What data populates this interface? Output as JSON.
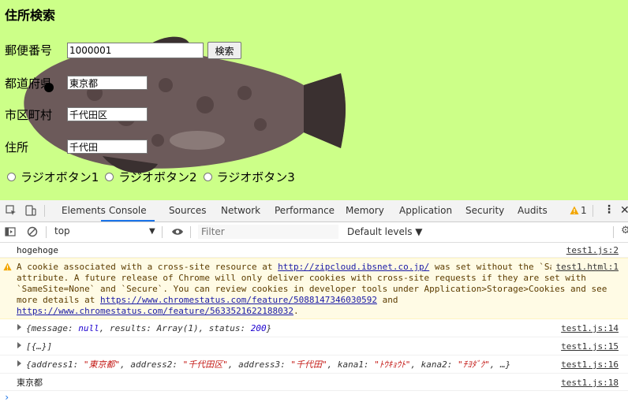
{
  "page": {
    "title": "住所検索",
    "zip_label": "郵便番号",
    "zip_value": "1000001",
    "search_button": "検索",
    "pref_label": "都道府県",
    "pref_value": "東京都",
    "city_label": "市区町村",
    "city_value": "千代田区",
    "address_label": "住所",
    "address_value": "千代田",
    "radios": [
      "ラジオボタン1",
      "ラジオボタン2",
      "ラジオボタン3"
    ],
    "background_color": "#ccff88"
  },
  "devtools": {
    "tabs": [
      "Elements",
      "Console",
      "Sources",
      "Network",
      "Performance",
      "Memory",
      "Application",
      "Security",
      "Audits"
    ],
    "active_tab": "Console",
    "warning_count": "1",
    "context": "top",
    "filter_placeholder": "Filter",
    "levels": "Default levels ▼",
    "messages": {
      "m1": {
        "text": "hogehoge",
        "source": "test1.js:2"
      },
      "m2": {
        "text_before": "A cookie associated with a cross-site resource at ",
        "link1": "http://zipcloud.ibsnet.co.jp/",
        "text_mid": " was set without the `SameSite` attribute. A future release of Chrome will only deliver cookies with cross-site requests if they are set with `SameSite=None` and `Secure`. You can review cookies in developer tools under Application>Storage>Cookies and see more details at ",
        "link2": "https://www.chromestatus.com/feature/5088147346030592",
        "text_and": " and ",
        "link3": "https://www.chromestatus.com/feature/5633521622188032",
        "text_end": ".",
        "source": "test1.html:1"
      },
      "m3": {
        "p1": "{message: ",
        "v1": "null",
        "p2": ", results: Array(1), status: ",
        "v2": "200",
        "p3": "}",
        "source": "test1.js:14"
      },
      "m4": {
        "text": "[{…}]",
        "source": "test1.js:15"
      },
      "m5": {
        "p1": "{address1: ",
        "v1": "\"東京都\"",
        "p2": ", address2: ",
        "v2": "\"千代田区\"",
        "p3": ", address3: ",
        "v3": "\"千代田\"",
        "p4": ", kana1: ",
        "v4": "\"ﾄｳｷｮｳﾄ\"",
        "p5": ", kana2: ",
        "v5": "\"ﾁﾖﾀﾞｸ\"",
        "p6": ", …}",
        "source": "test1.js:16"
      },
      "m6": {
        "text": "東京都",
        "source": "test1.js:18"
      }
    },
    "prompt": "›"
  }
}
